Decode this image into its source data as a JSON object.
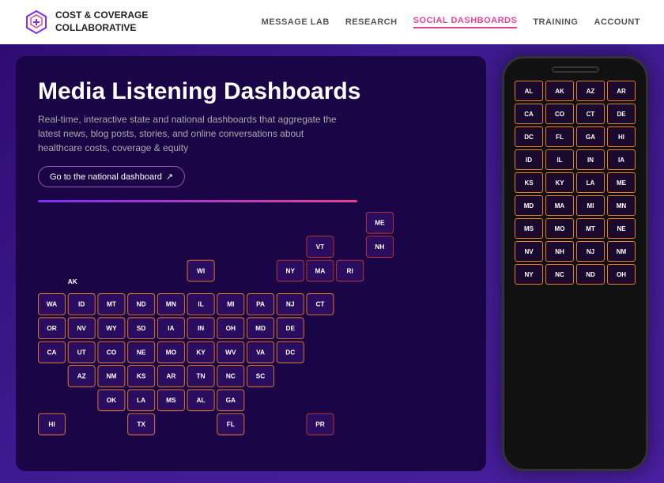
{
  "header": {
    "logo_line1": "COST & COVERAGE",
    "logo_line2": "COLLABORATIVE",
    "nav": [
      {
        "label": "MESSAGE LAB",
        "active": false
      },
      {
        "label": "RESEARCH",
        "active": false
      },
      {
        "label": "SOCIAL DASHBOARDS",
        "active": true
      },
      {
        "label": "TRAINING",
        "active": false
      },
      {
        "label": "ACCOUNT",
        "active": false
      }
    ]
  },
  "dashboard": {
    "title": "Media Listening Dashboards",
    "subtitle": "Real-time, interactive state and national dashboards that aggregate the latest news, blog posts, stories, and online conversations about healthcare costs, coverage & equity",
    "cta_label": "Go to the national dashboard",
    "states_map": [
      {
        "row": [
          {
            "spacer": true
          },
          {
            "spacer": true
          },
          {
            "spacer": true
          },
          {
            "spacer": true
          },
          {
            "spacer": true
          },
          {
            "spacer": true
          },
          {
            "spacer": true
          },
          {
            "spacer": true
          },
          {
            "spacer": true
          },
          {
            "spacer": true
          },
          {
            "spacer": true
          },
          {
            "label": "ME"
          }
        ]
      },
      {
        "row": [
          {
            "spacer": true
          },
          {
            "spacer": true
          },
          {
            "spacer": true
          },
          {
            "spacer": true
          },
          {
            "spacer": true
          },
          {
            "spacer": true
          },
          {
            "spacer": true
          },
          {
            "spacer": true
          },
          {
            "spacer": true
          },
          {
            "label": "VT"
          },
          {
            "spacer": true
          },
          {
            "label": "NH"
          }
        ]
      },
      {
        "row": [
          {
            "spacer": true
          },
          {
            "spacer": true
          },
          {
            "spacer": true
          },
          {
            "spacer": true
          },
          {
            "spacer": true
          },
          {
            "label": "WI"
          },
          {
            "spacer": true
          },
          {
            "spacer": true
          },
          {
            "label": "NY"
          },
          {
            "label": "MA"
          },
          {
            "label": "RI"
          }
        ]
      },
      {
        "row": [
          {
            "spacer": true
          },
          {
            "label": "AK"
          },
          {
            "spacer": true
          },
          {
            "spacer": true
          },
          {
            "spacer": true
          },
          {
            "spacer": true
          },
          {
            "spacer": true
          },
          {
            "spacer": true
          },
          {
            "spacer": true
          },
          {
            "spacer": true
          },
          {
            "spacer": true
          },
          {
            "spacer": true
          }
        ]
      },
      {
        "row": [
          {
            "label": "WA"
          },
          {
            "label": "ID"
          },
          {
            "label": "MT"
          },
          {
            "label": "ND"
          },
          {
            "label": "MN"
          },
          {
            "label": "IL"
          },
          {
            "label": "MI"
          },
          {
            "label": "PA"
          },
          {
            "label": "NJ"
          },
          {
            "label": "CT"
          }
        ]
      },
      {
        "row": [
          {
            "label": "OR"
          },
          {
            "label": "NV"
          },
          {
            "label": "WY"
          },
          {
            "label": "SD"
          },
          {
            "label": "IA"
          },
          {
            "label": "IN"
          },
          {
            "label": "OH"
          },
          {
            "label": "MD"
          },
          {
            "label": "DE"
          }
        ]
      },
      {
        "row": [
          {
            "label": "CA"
          },
          {
            "label": "UT"
          },
          {
            "label": "CO"
          },
          {
            "label": "NE"
          },
          {
            "label": "MO"
          },
          {
            "label": "KY"
          },
          {
            "label": "WV"
          },
          {
            "label": "VA"
          },
          {
            "label": "DC"
          }
        ]
      },
      {
        "row": [
          {
            "spacer": true
          },
          {
            "label": "AZ"
          },
          {
            "label": "NM"
          },
          {
            "label": "KS"
          },
          {
            "label": "AR"
          },
          {
            "label": "TN"
          },
          {
            "label": "NC"
          },
          {
            "label": "SC"
          }
        ]
      },
      {
        "row": [
          {
            "spacer": true
          },
          {
            "spacer": true
          },
          {
            "label": "OK"
          },
          {
            "label": "LA"
          },
          {
            "label": "MS"
          },
          {
            "label": "AL"
          },
          {
            "label": "GA"
          }
        ]
      },
      {
        "row": [
          {
            "label": "HI"
          },
          {
            "spacer": true
          },
          {
            "spacer": true
          },
          {
            "label": "TX"
          },
          {
            "spacer": true
          },
          {
            "spacer": true
          },
          {
            "label": "FL"
          },
          {
            "spacer": true
          },
          {
            "spacer": true
          },
          {
            "label": "PR"
          }
        ]
      }
    ]
  },
  "phone": {
    "rows": [
      [
        "AL",
        "AK",
        "AZ",
        "AR"
      ],
      [
        "CA",
        "CO",
        "CT",
        "DE"
      ],
      [
        "DC",
        "FL",
        "GA",
        "HI"
      ],
      [
        "ID",
        "IL",
        "IN",
        "IA"
      ],
      [
        "KS",
        "KY",
        "LA",
        "ME"
      ],
      [
        "MD",
        "MA",
        "MI",
        "MN"
      ],
      [
        "MS",
        "MO",
        "MT",
        "NE"
      ],
      [
        "NV",
        "NH",
        "NJ",
        "NM"
      ],
      [
        "NY",
        "NC",
        "ND",
        "OH"
      ]
    ]
  }
}
